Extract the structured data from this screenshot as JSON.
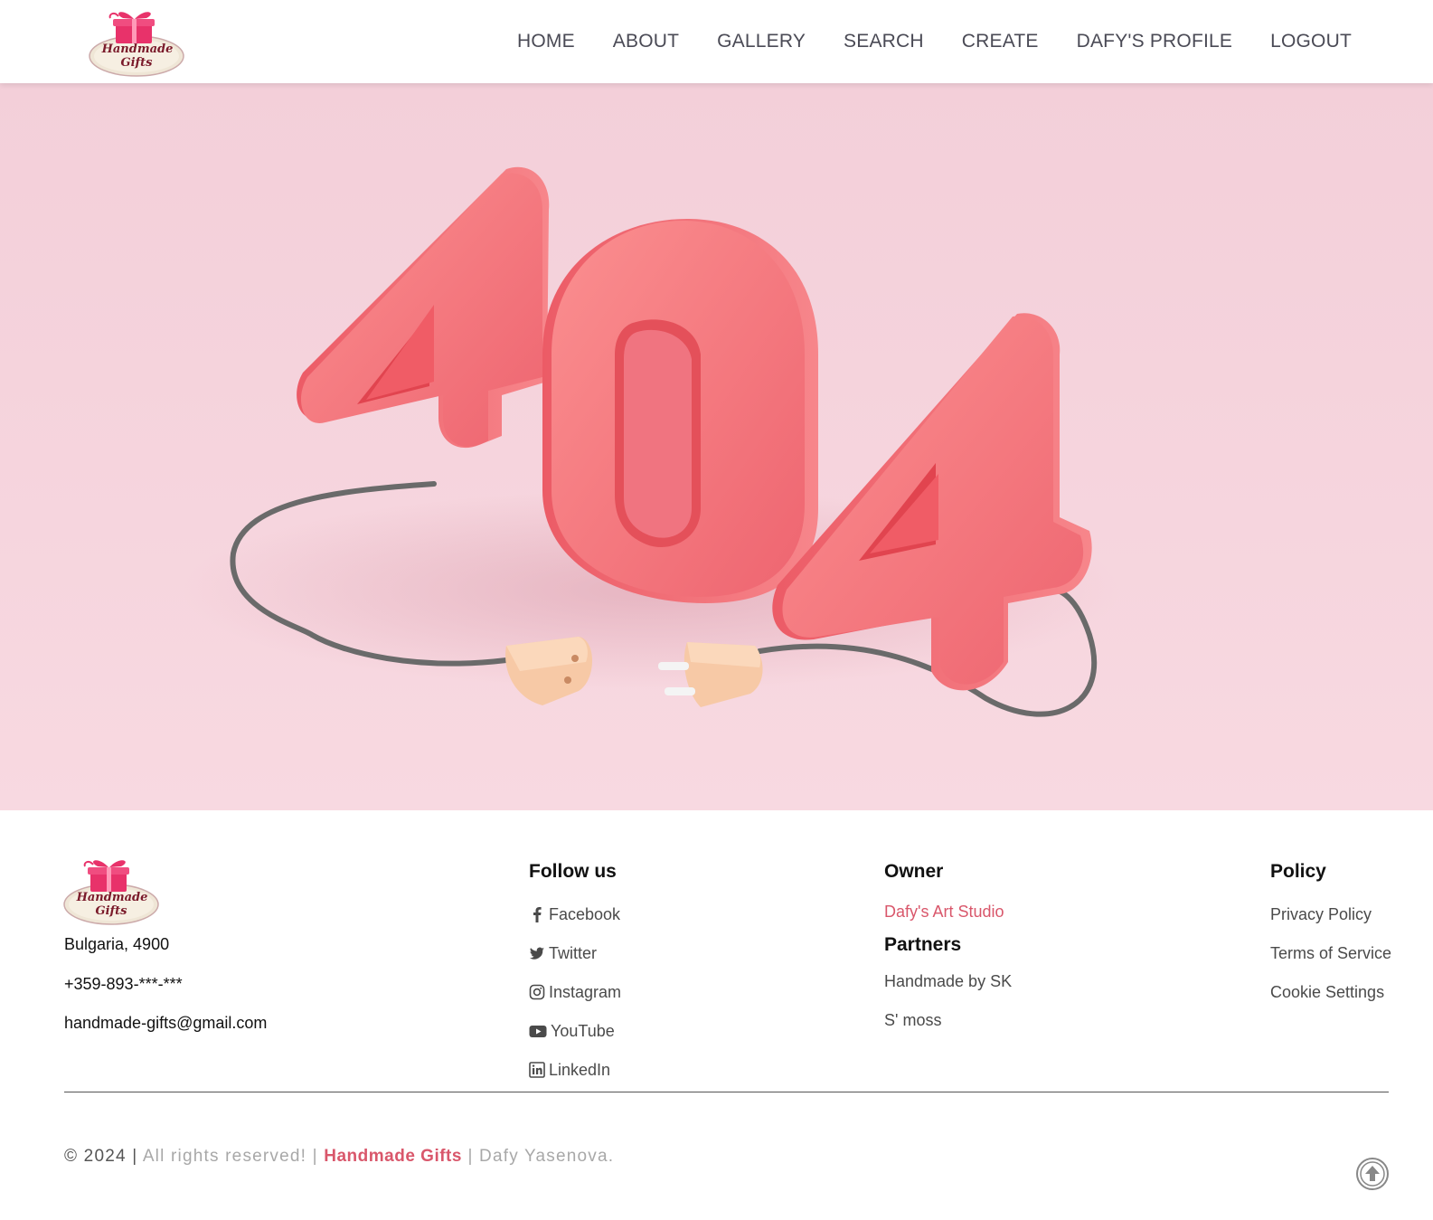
{
  "header": {
    "logo_text": [
      "Handmade",
      "Gifts"
    ],
    "nav": [
      {
        "label": "HOME"
      },
      {
        "label": "ABOUT"
      },
      {
        "label": "GALLERY"
      },
      {
        "label": "SEARCH"
      },
      {
        "label": "CREATE"
      },
      {
        "label": "DAFY'S PROFILE"
      },
      {
        "label": "LOGOUT"
      }
    ]
  },
  "hero": {
    "error_code": "404",
    "icon": "unplugged-404-illustration",
    "background_color": "#f5cdd9",
    "accent_color": "#f06d78"
  },
  "footer": {
    "logo_text": [
      "Handmade",
      "Gifts"
    ],
    "contact": {
      "address": "Bulgaria, 4900",
      "phone": "+359-893-***-***",
      "email": "handmade-gifts@gmail.com"
    },
    "follow": {
      "title": "Follow us",
      "links": [
        {
          "label": "Facebook",
          "icon": "facebook-icon"
        },
        {
          "label": "Twitter",
          "icon": "twitter-icon"
        },
        {
          "label": "Instagram",
          "icon": "instagram-icon"
        },
        {
          "label": "YouTube",
          "icon": "youtube-icon"
        },
        {
          "label": "LinkedIn",
          "icon": "linkedin-icon"
        }
      ]
    },
    "owner": {
      "title": "Owner",
      "studio": "Dafy's Art Studio",
      "partners_title": "Partners",
      "partners": [
        "Handmade by SK",
        "S' moss"
      ]
    },
    "policy": {
      "title": "Policy",
      "links": [
        "Privacy Policy",
        "Terms of Service",
        "Cookie Settings"
      ]
    },
    "copyright": {
      "year": "© 2024 |",
      "rights": "All rights reserved! |",
      "brand": "Handmade Gifts",
      "author": "| Dafy Yasenova."
    },
    "brand_color": "#d9576b"
  }
}
